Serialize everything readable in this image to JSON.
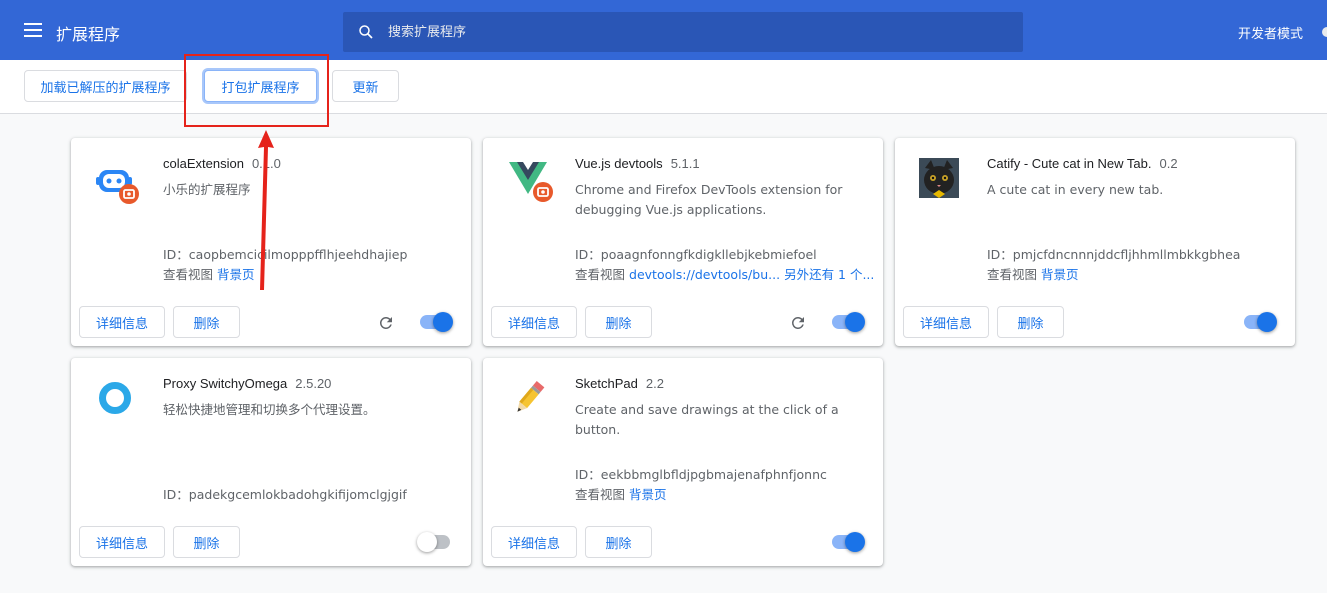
{
  "header": {
    "title": "扩展程序",
    "search_placeholder": "搜索扩展程序",
    "dev_mode_label": "开发者模式"
  },
  "toolbar": {
    "load_unpacked": "加载已解压的扩展程序",
    "pack_extension": "打包扩展程序",
    "update": "更新"
  },
  "buttons": {
    "details": "详细信息",
    "remove": "删除"
  },
  "extensions": [
    {
      "name": "colaExtension",
      "version": "0.1.0",
      "description": "小乐的扩展程序",
      "id": "ID：caopbemcicilmopppfflhjeehdhajiep",
      "views_label": "查看视图",
      "views": [
        "背景页"
      ],
      "enabled": true,
      "reloadable": true,
      "icon": "robot-icon"
    },
    {
      "name": "Vue.js devtools",
      "version": "5.1.1",
      "description": "Chrome and Firefox DevTools extension for debugging Vue.js applications.",
      "id": "ID：poaagnfonngfkdigkllebjkebmiefoel",
      "views_label": "查看视图",
      "views": [
        "devtools://devtools/bu...",
        "另外还有 1 个..."
      ],
      "enabled": true,
      "reloadable": true,
      "icon": "vue-icon"
    },
    {
      "name": "Catify - Cute cat in New Tab.",
      "version": "0.2",
      "description": "A cute cat in every new tab.",
      "id": "ID：pmjcfdncnnnjddcfljhhmllmbkkgbhea",
      "views_label": "查看视图",
      "views": [
        "背景页"
      ],
      "enabled": true,
      "reloadable": false,
      "icon": "cat-icon"
    },
    {
      "name": "Proxy SwitchyOmega",
      "version": "2.5.20",
      "description": "轻松快捷地管理和切换多个代理设置。",
      "id": "ID：padekgcemlokbadohgkifijomclgjgif",
      "views_label": "",
      "views": [],
      "enabled": false,
      "reloadable": false,
      "icon": "omega-ring-icon"
    },
    {
      "name": "SketchPad",
      "version": "2.2",
      "description": "Create and save drawings at the click of a button.",
      "id": "ID：eekbbmglbfldjpgbmajenafphnfjonnc",
      "views_label": "查看视图",
      "views": [
        "背景页"
      ],
      "enabled": true,
      "reloadable": false,
      "icon": "pencil-icon"
    }
  ],
  "colors": {
    "header": "#3367d6",
    "accent": "#1a73e8",
    "annotation": "#e5231b"
  }
}
